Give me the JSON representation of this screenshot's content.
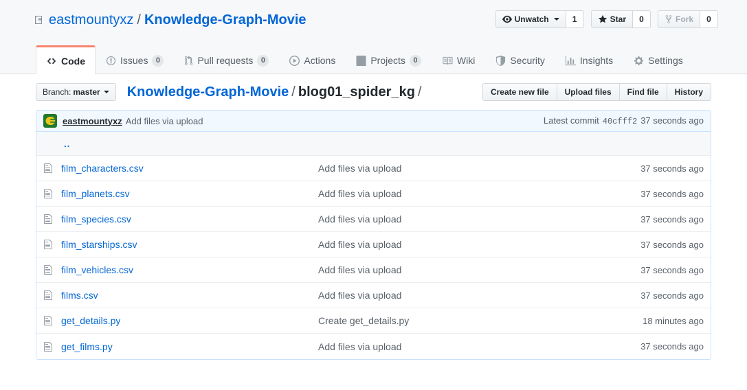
{
  "header": {
    "repo_icon": "repo-book-icon",
    "owner": "eastmountyxz",
    "separator": "/",
    "repo_name": "Knowledge-Graph-Movie",
    "actions": [
      {
        "icon": "eye-icon",
        "label": "Unwatch",
        "count": "1",
        "has_caret": true,
        "disabled": false
      },
      {
        "icon": "star-icon",
        "label": "Star",
        "count": "0",
        "has_caret": false,
        "disabled": false
      },
      {
        "icon": "fork-icon",
        "label": "Fork",
        "count": "0",
        "has_caret": false,
        "disabled": true
      }
    ],
    "tabs": [
      {
        "icon": "code-icon",
        "label": "Code",
        "count": null,
        "selected": true
      },
      {
        "icon": "issue-opened-icon",
        "label": "Issues",
        "count": "0",
        "selected": false
      },
      {
        "icon": "git-pull-request-icon",
        "label": "Pull requests",
        "count": "0",
        "selected": false
      },
      {
        "icon": "play-icon",
        "label": "Actions",
        "count": null,
        "selected": false
      },
      {
        "icon": "project-icon",
        "label": "Projects",
        "count": "0",
        "selected": false
      },
      {
        "icon": "book-icon",
        "label": "Wiki",
        "count": null,
        "selected": false
      },
      {
        "icon": "shield-icon",
        "label": "Security",
        "count": null,
        "selected": false
      },
      {
        "icon": "graph-icon",
        "label": "Insights",
        "count": null,
        "selected": false
      },
      {
        "icon": "gear-icon",
        "label": "Settings",
        "count": null,
        "selected": false
      }
    ]
  },
  "subnav": {
    "branch_prefix": "Branch:",
    "branch_name": "master",
    "breadcrumb": {
      "repo": "Knowledge-Graph-Movie",
      "slash1": "/",
      "folder": "blog01_spider_kg",
      "slash2": "/"
    },
    "file_actions": [
      {
        "label": "Create new file"
      },
      {
        "label": "Upload files"
      },
      {
        "label": "Find file"
      },
      {
        "label": "History"
      }
    ]
  },
  "commit_bar": {
    "avatar": "user-avatar",
    "author": "eastmountyxz",
    "message": "Add files via upload",
    "latest_commit_label": "Latest commit",
    "sha": "40cfff2",
    "age": "37 seconds ago"
  },
  "file_list": {
    "parent_dir": "..",
    "rows": [
      {
        "icon": "file-icon",
        "name": "film_characters.csv",
        "message": "Add files via upload",
        "age": "37 seconds ago"
      },
      {
        "icon": "file-icon",
        "name": "film_planets.csv",
        "message": "Add files via upload",
        "age": "37 seconds ago"
      },
      {
        "icon": "file-icon",
        "name": "film_species.csv",
        "message": "Add files via upload",
        "age": "37 seconds ago"
      },
      {
        "icon": "file-icon",
        "name": "film_starships.csv",
        "message": "Add files via upload",
        "age": "37 seconds ago"
      },
      {
        "icon": "file-icon",
        "name": "film_vehicles.csv",
        "message": "Add files via upload",
        "age": "37 seconds ago"
      },
      {
        "icon": "file-icon",
        "name": "films.csv",
        "message": "Add files via upload",
        "age": "37 seconds ago"
      },
      {
        "icon": "file-icon",
        "name": "get_details.py",
        "message": "Create get_details.py",
        "age": "18 minutes ago"
      },
      {
        "icon": "file-icon",
        "name": "get_films.py",
        "message": "Add files via upload",
        "age": "37 seconds ago"
      }
    ]
  },
  "colors": {
    "link": "#0366d6",
    "header_bg": "#f6f8fa",
    "selected_tab_accent": "#f9826c",
    "commit_bar_bg": "#f1f8ff",
    "commit_bar_border": "#c8e1ff",
    "muted_text": "#586069",
    "avatar_bg": "#1f7a2e",
    "avatar_fg": "#e8c51d"
  }
}
